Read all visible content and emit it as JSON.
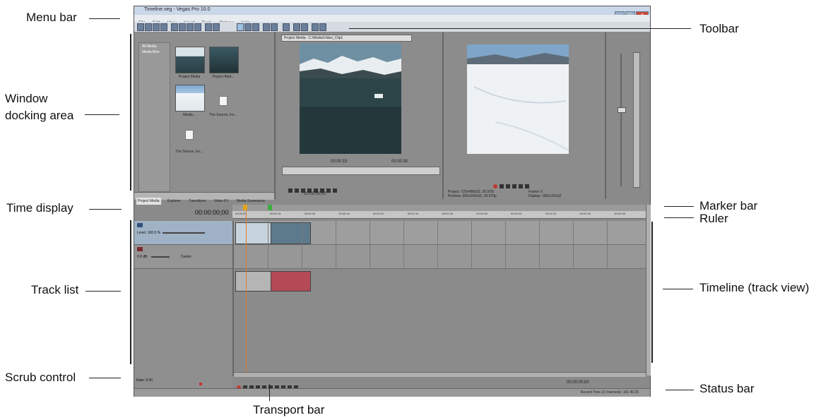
{
  "callouts": {
    "menu_bar": "Menu bar",
    "toolbar": "Toolbar",
    "window_docking_area": "Window\ndocking area",
    "time_display": "Time display",
    "marker_bar": "Marker bar",
    "ruler": "Ruler",
    "track_list": "Track list",
    "timeline": "Timeline (track view)",
    "scrub_control": "Scrub control",
    "status_bar": "Status bar",
    "transport_bar": "Transport bar"
  },
  "app": {
    "title": "Timeline.veg - Vegas Pro 10.0",
    "menu": [
      "File",
      "Edit",
      "View",
      "Insert",
      "Tools",
      "Options",
      "Help"
    ],
    "window_buttons": [
      "_",
      "□",
      "×"
    ],
    "time_display_value": "00:00:00;00",
    "trimmer_field": "Project Media - C:\\Media\\Video_Clip1",
    "explorer_tree": [
      "All Media",
      "Media Bins"
    ],
    "explorer_items": [
      "Project Media",
      "Project Med...",
      "Media...",
      "The Source, Inc...",
      "The Source, Inc..."
    ],
    "dock_tabs": [
      "Project Media",
      "Explorer",
      "Transitions",
      "Video FX",
      "Media Generators"
    ],
    "preview_info": [
      "Project: 720x480x32, 29.970i",
      "Preview: 360x240x32, 29.970p",
      "Frame: 0",
      "Display: 180x120x32"
    ],
    "track1_level": "Level: 100.0 %",
    "track2_vol": "0.0 dB",
    "track2_pan": "Center",
    "ruler_ticks": [
      "00:00:00",
      "00:00:15",
      "00:00:30",
      "00:00:45",
      "00:01:00",
      "00:01:15",
      "00:01:30",
      "00:01:45",
      "00:02:00",
      "00:02:15",
      "00:02:30",
      "00:02:45"
    ],
    "scrub_rate": "Rate: 0.00",
    "status": "Record Time (2 channels): 101:40:25",
    "transport_time": "00:00:00;00"
  },
  "colors": {
    "app_bg": "#8a8a8a",
    "cursor": "#e07a2a",
    "audio_clip": "#b34a55",
    "video_track_header": "#9fb2c6"
  }
}
